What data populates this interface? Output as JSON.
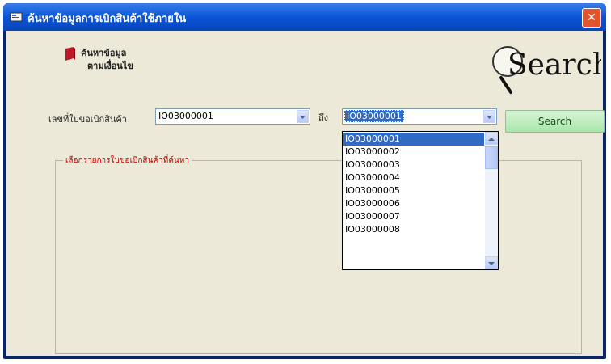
{
  "window": {
    "title": "ค้นหาข้อมูลการเบิกสินค้าใช้ภายใน",
    "close_symbol": "✕"
  },
  "brand": {
    "line1": "ค้นหาข้อมูล",
    "line2": "ตามเงื่อนไข"
  },
  "logo": {
    "text": "Search"
  },
  "filter": {
    "from_label": "เลขที่ใบขอเบิกสินค้า",
    "from_value": "IO03000001",
    "to_label": "ถึง",
    "to_value": "IO03000001"
  },
  "search_button": {
    "label": "Search"
  },
  "dropdown": {
    "options": [
      "IO03000001",
      "IO03000002",
      "IO03000003",
      "IO03000004",
      "IO03000005",
      "IO03000006",
      "IO03000007",
      "IO03000008"
    ],
    "selected_index": 0
  },
  "results": {
    "label": "เลือกรายการใบขอเบิกสินค้าที่ค้นหา"
  },
  "colors": {
    "titlebar": "#0a55d8",
    "highlight": "#316ac5",
    "search_button": "#b9ebb9",
    "group_label": "#cc0000"
  }
}
